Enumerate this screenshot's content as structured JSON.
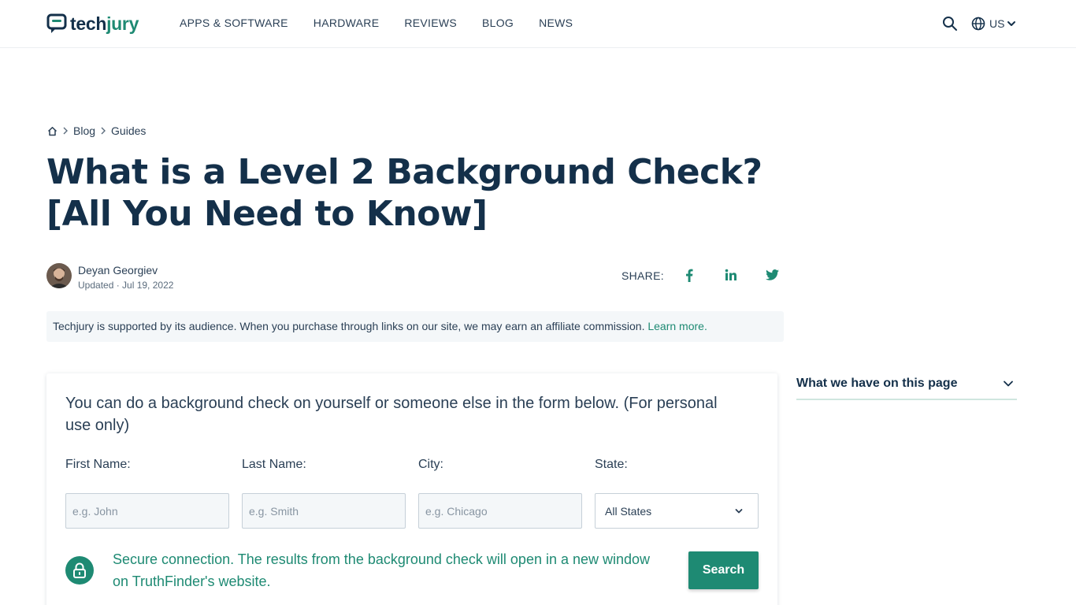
{
  "header": {
    "logo": {
      "part1": "tech",
      "part2": "jury"
    },
    "nav": [
      {
        "label": "APPS & SOFTWARE"
      },
      {
        "label": "HARDWARE"
      },
      {
        "label": "REVIEWS"
      },
      {
        "label": "BLOG"
      },
      {
        "label": "NEWS"
      }
    ],
    "search_icon": "search-icon",
    "locale": {
      "icon": "globe-icon",
      "label": "US"
    }
  },
  "breadcrumb": {
    "home_icon": "home-icon",
    "items": [
      {
        "label": "Blog"
      },
      {
        "label": "Guides"
      }
    ]
  },
  "article": {
    "title": "What is a Level 2 Background Check? [All You Need to Know]",
    "author": {
      "name": "Deyan Georgiev",
      "meta": "Updated · Jul 19, 2022"
    },
    "share": {
      "label": "SHARE:",
      "networks": [
        {
          "icon": "facebook-icon"
        },
        {
          "icon": "linkedin-icon"
        },
        {
          "icon": "twitter-icon"
        }
      ]
    },
    "disclosure": {
      "text": "Techjury is supported by its audience. When you purchase through links on our site, we may earn an affiliate commission. ",
      "link": "Learn more."
    }
  },
  "form": {
    "intro": "You can do a background check on yourself or someone else in the form below. (For personal use only)",
    "fields": [
      {
        "label": "First Name:",
        "placeholder": "e.g. John"
      },
      {
        "label": "Last Name:",
        "placeholder": "e.g. Smith"
      },
      {
        "label": "City:",
        "placeholder": "e.g. Chicago"
      }
    ],
    "state": {
      "label": "State:",
      "selected": "All States"
    },
    "secure_text": "Secure connection. The results from the background check will open in a new window on TruthFinder's website.",
    "submit_label": "Search"
  },
  "toc": {
    "title": "What we have on this page"
  },
  "colors": {
    "brand": "#1e8a73",
    "navy": "#14304a",
    "muted_bg": "#f4f7f9"
  }
}
